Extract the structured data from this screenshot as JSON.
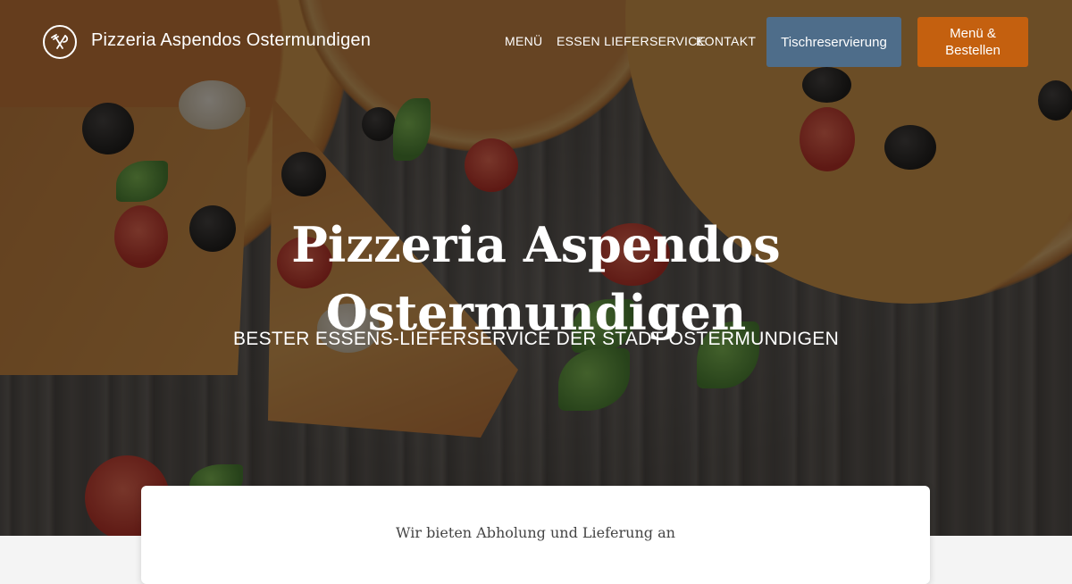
{
  "header": {
    "brand": "Pizzeria Aspendos Ostermundigen",
    "logo_icon": "fork-knife-icon",
    "nav": [
      {
        "label": "MENÜ"
      },
      {
        "label": "ESSEN LIEFERSERVICE"
      },
      {
        "label": "KONTAKT"
      }
    ],
    "reserve_button": "Tischreservierung",
    "order_button": "Menü & Bestellen"
  },
  "hero": {
    "title": "Pizzeria Aspendos Ostermundigen",
    "subtitle": "BESTER ESSENS-LIEFERSERVICE DER STADT OSTERMUNDIGEN"
  },
  "card": {
    "text": "Wir bieten Abholung und Lieferung an"
  },
  "colors": {
    "reserve_button": "#4e6d8a",
    "order_button": "#c4600f"
  }
}
